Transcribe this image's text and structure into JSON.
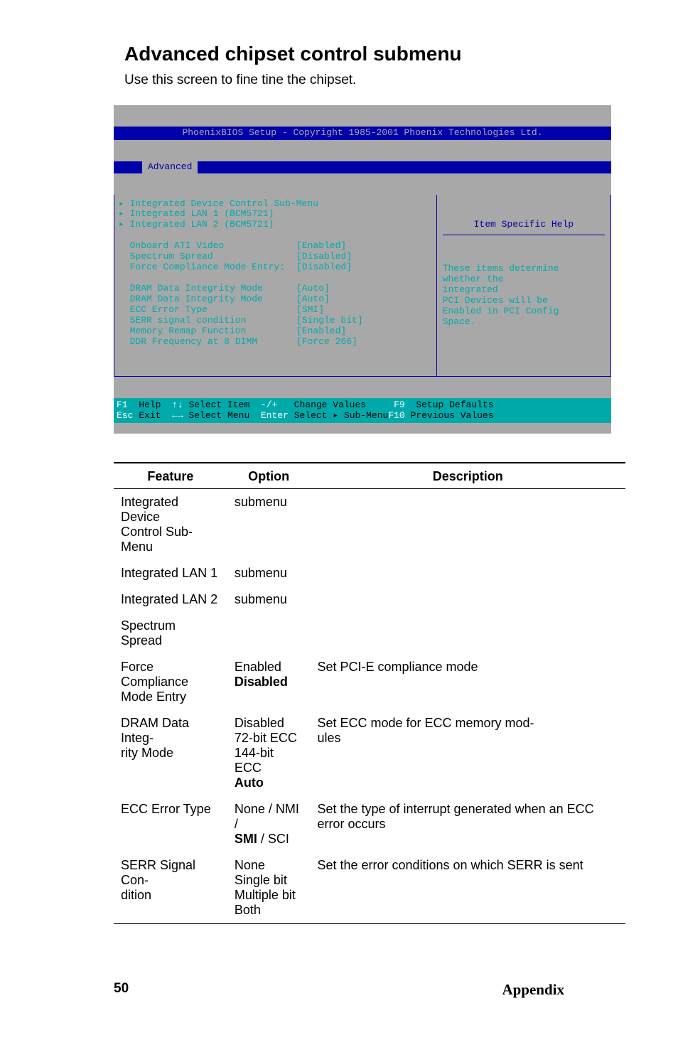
{
  "title": "Advanced chipset control submenu",
  "subtitle": "Use this screen to fine tine the chipset.",
  "bios": {
    "title": "PhoenixBIOS Setup - Copyright 1985-2001 Phoenix Technologies Ltd.",
    "tab": "Advanced",
    "left": {
      "menus": [
        "Integrated Device Control Sub-Menu",
        "Integrated LAN 1 (BCM5721)",
        "Integrated LAN 2 (BCM5721)"
      ],
      "settings": [
        {
          "label": "Onboard ATI Video",
          "value": "[Enabled]"
        },
        {
          "label": "Spectrum Spread",
          "value": "[Disabled]"
        },
        {
          "label": "Force Compliance Mode Entry:",
          "value": "[Disabled]"
        },
        {
          "label": "DRAM Data Integrity Mode",
          "value": "[Auto]"
        },
        {
          "label": "DRAM Data Integrity Mode",
          "value": "[Auto]"
        },
        {
          "label": "ECC Error Type",
          "value": "[SMI]"
        },
        {
          "label": "SERR signal condition",
          "value": "[Single bit]"
        },
        {
          "label": "Memory Remap Function",
          "value": "[Enabled]"
        },
        {
          "label": "DDR Frequency at 8 DIMM",
          "value": "[Force 266]"
        }
      ]
    },
    "right": {
      "title": "Item Specific Help",
      "body": "These items determine\nwhether the\nintegrated\nPCI Devices will be\nEnabled in PCI Config\nSpace."
    },
    "footer": {
      "l1a": "F1",
      "l1b": "Help",
      "l1c": "↑↓",
      "l1d": "Select Item",
      "l1e": "-/+",
      "l1f": "Change Values",
      "l1g": "F9",
      "l1h": "Setup Defaults",
      "l2a": "Esc",
      "l2b": "Exit",
      "l2c": "←→",
      "l2d": "Select Menu",
      "l2e": "Enter",
      "l2f": "Select ▸ Sub-Menu",
      "l2g": "F10",
      "l2h": "Previous Values"
    }
  },
  "table": {
    "headers": [
      "Feature",
      "Option",
      "Description"
    ],
    "rows": [
      {
        "f": "Integrated Device Control Sub-Menu",
        "o": "submenu",
        "d": ""
      },
      {
        "f": "Integrated LAN 1",
        "o": "submenu",
        "d": ""
      },
      {
        "f": "Integrated LAN 2",
        "o": "submenu",
        "d": ""
      },
      {
        "f": "Spectrum Spread",
        "o": "",
        "d": ""
      },
      {
        "f": "Force Compliance Mode Entry",
        "o": "Enabled\nDisabled",
        "obold": 1,
        "d": "Set PCI-E compliance mode"
      },
      {
        "f": "DRAM Data Integ-rity Mode",
        "o": "Disabled\n72-bit ECC\n144-bit ECC\nAuto",
        "obold": 3,
        "d": "Set ECC mode for ECC memory mod-ules"
      },
      {
        "f": "ECC Error Type",
        "o": "None / NMI /\nSMI / SCI",
        "obold_inline": "SMI",
        "d": "Set the type of interrupt generated when an ECC error occurs"
      },
      {
        "f": "SERR Signal Con-dition",
        "o": "None\nSingle bit\nMultiple bit\nBoth",
        "d": "Set the error conditions on which SERR is sent"
      }
    ]
  },
  "foot": {
    "pageno": "50",
    "section": "Appendix"
  }
}
